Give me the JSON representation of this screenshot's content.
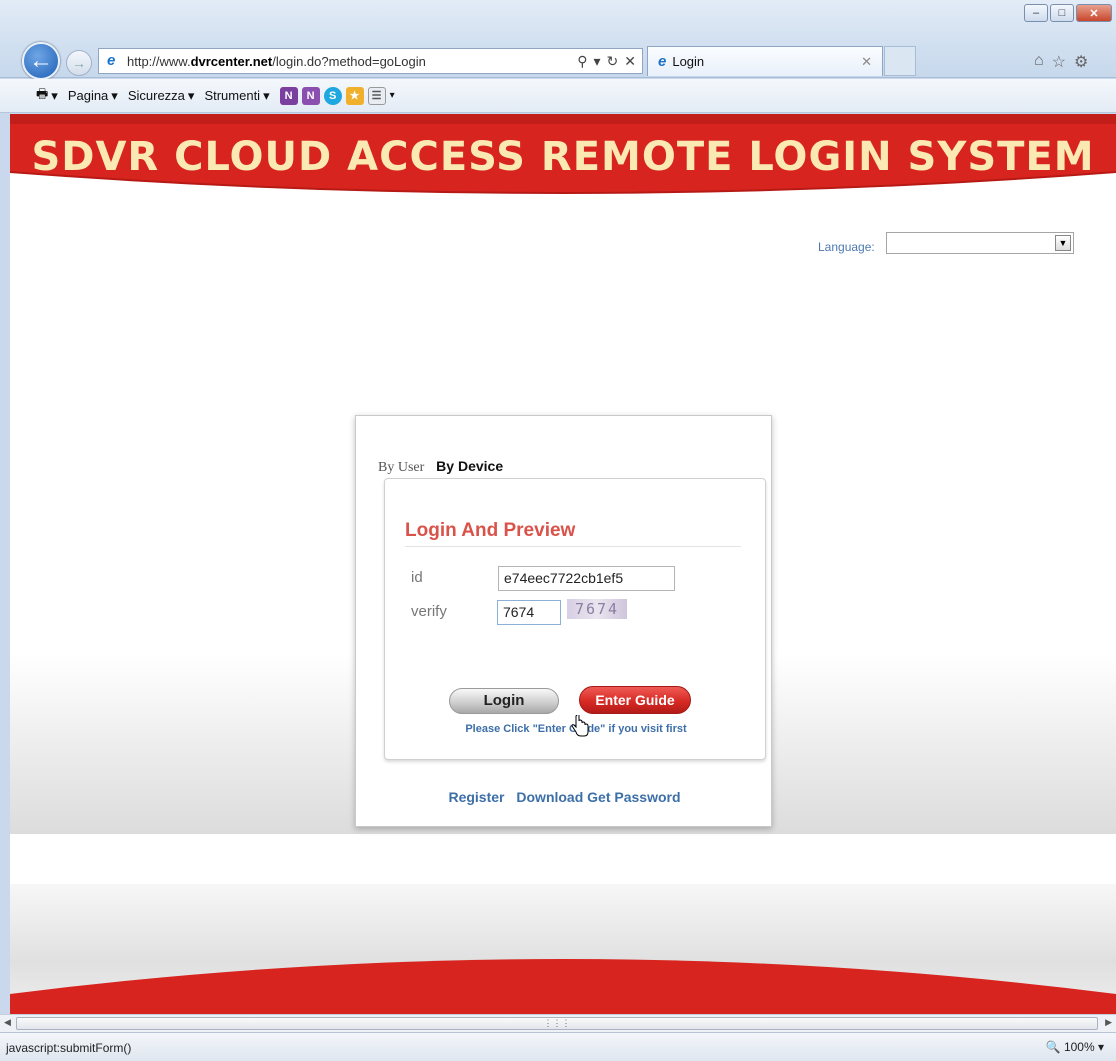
{
  "browser": {
    "url_prefix": "http://www.",
    "url_domain": "dvrcenter.net",
    "url_path": "/login.do?method=goLogin",
    "tab_title": "Login",
    "commands": [
      "Pagina",
      "Sicurezza",
      "Strumenti"
    ]
  },
  "page": {
    "banner_title": "SDVR CLOUD ACCESS REMOTE LOGIN SYSTEM",
    "language_label": "Language:",
    "language_value": "",
    "tabs": {
      "by_user": "By User",
      "by_device": "By Device"
    },
    "form": {
      "title": "Login And Preview",
      "id_label": "id",
      "id_value": "e74eec7722cb1ef5",
      "verify_label": "verify",
      "verify_value": "7674",
      "captcha_text": "7674",
      "login_button": "Login",
      "guide_button": "Enter Guide",
      "hint": "Please Click \"Enter Guide\" if you visit first"
    },
    "links": {
      "register": "Register",
      "download": "Download Get Password"
    }
  },
  "status": {
    "text": "javascript:submitForm()",
    "zoom": "100%"
  },
  "colors": {
    "banner_red": "#d8241e",
    "accent_title": "#d9534a",
    "link_blue": "#3d6fa8"
  }
}
